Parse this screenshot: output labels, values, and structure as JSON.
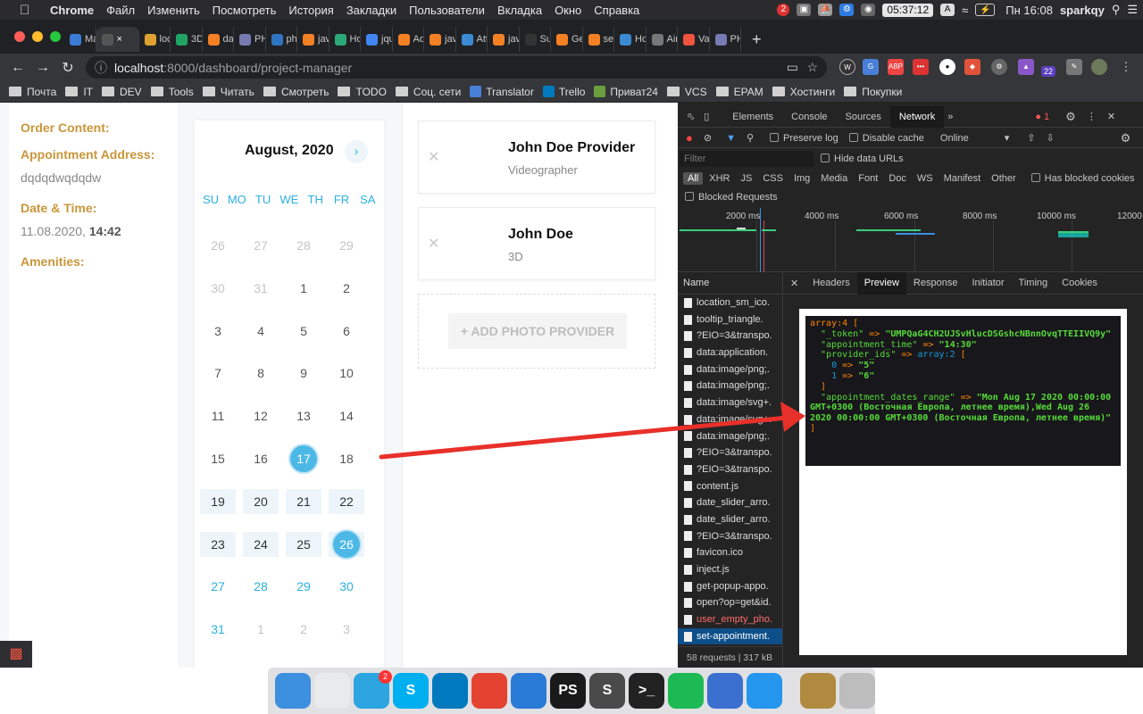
{
  "menubar": {
    "app": "Chrome",
    "items": [
      "Файл",
      "Изменить",
      "Посмотреть",
      "История",
      "Закладки",
      "Пользователи",
      "Вкладка",
      "Окно",
      "Справка"
    ],
    "clock": "05:37:12",
    "input_lang": "A",
    "datetime": "Пн 16:08",
    "user": "sparkqy",
    "notif_badge": "2"
  },
  "tabs": [
    {
      "label": "Mai",
      "icon": "pm-icon",
      "color": "#3a7bd5"
    },
    {
      "label": "",
      "icon": "chrome-icon",
      "color": "#555",
      "active": true
    },
    {
      "label": "loca",
      "icon": "laravel-icon",
      "color": "#e0a030"
    },
    {
      "label": "3D",
      "icon": "sheets-icon",
      "color": "#1fa463"
    },
    {
      "label": "date",
      "icon": "so-icon",
      "color": "#f48024"
    },
    {
      "label": "PHP",
      "icon": "php-icon",
      "color": "#777bb3"
    },
    {
      "label": "php",
      "icon": "php-doc-icon",
      "color": "#2f74c0"
    },
    {
      "label": "java",
      "icon": "so-icon",
      "color": "#f48024"
    },
    {
      "label": "How",
      "icon": "hex-icon",
      "color": "#2aa876"
    },
    {
      "label": "jquery",
      "icon": "google-icon",
      "color": "#4285f4"
    },
    {
      "label": "Add",
      "icon": "so-icon",
      "color": "#f48024"
    },
    {
      "label": "java",
      "icon": "so-icon",
      "color": "#f48024"
    },
    {
      "label": "Attr",
      "icon": "wave-icon",
      "color": "#3b8bd4"
    },
    {
      "label": "java",
      "icon": "so-icon",
      "color": "#f48024"
    },
    {
      "label": "Sub",
      "icon": "github-icon",
      "color": "#333"
    },
    {
      "label": "Get",
      "icon": "so-icon",
      "color": "#f48024"
    },
    {
      "label": "seri",
      "icon": "so-icon",
      "color": "#f48024"
    },
    {
      "label": "How",
      "icon": "wave-icon",
      "color": "#3b8bd4"
    },
    {
      "label": "Air",
      "icon": "globe-icon",
      "color": "#777"
    },
    {
      "label": "Vali",
      "icon": "laravel-icon",
      "color": "#f05340"
    },
    {
      "label": "PHP",
      "icon": "php-icon",
      "color": "#777bb3"
    }
  ],
  "address": {
    "host": "localhost",
    "path": ":8000/dashboard/project-manager"
  },
  "ext_badge": "22",
  "bookmarks": [
    {
      "label": "Почта",
      "type": "folder"
    },
    {
      "label": "IT",
      "type": "folder"
    },
    {
      "label": "DEV",
      "type": "folder"
    },
    {
      "label": "Tools",
      "type": "folder"
    },
    {
      "label": "Читать",
      "type": "folder"
    },
    {
      "label": "Смотреть",
      "type": "folder"
    },
    {
      "label": "TODO",
      "type": "folder"
    },
    {
      "label": "Соц. сети",
      "type": "folder"
    },
    {
      "label": "Translator",
      "type": "site",
      "color": "#4a7fd8"
    },
    {
      "label": "Trello",
      "type": "site",
      "color": "#0079bf"
    },
    {
      "label": "Приват24",
      "type": "site",
      "color": "#6b9e3f"
    },
    {
      "label": "VCS",
      "type": "folder"
    },
    {
      "label": "EPAM",
      "type": "folder"
    },
    {
      "label": "Хостинги",
      "type": "folder"
    },
    {
      "label": "Покупки",
      "type": "folder"
    }
  ],
  "order": {
    "content_label": "Order Content:",
    "address_label": "Appointment Address:",
    "address_value": "dqdqdwqdqdw",
    "datetime_label": "Date & Time:",
    "date_value": "11.08.2020,",
    "time_value": "14:42",
    "amenities_label": "Amenities:"
  },
  "calendar": {
    "title": "August, 2020",
    "next_symbol": "›",
    "weekdays": [
      "SU",
      "MO",
      "TU",
      "WE",
      "TH",
      "FR",
      "SA"
    ],
    "weeks": [
      [
        {
          "d": "26",
          "s": "muted"
        },
        {
          "d": "27",
          "s": "muted"
        },
        {
          "d": "28",
          "s": "muted"
        },
        {
          "d": "29",
          "s": "muted"
        }
      ],
      [
        {
          "d": "30",
          "s": "muted"
        },
        {
          "d": "31",
          "s": "muted"
        },
        {
          "d": "1",
          "s": ""
        },
        {
          "d": "2",
          "s": ""
        }
      ],
      [
        {
          "d": "3",
          "s": ""
        },
        {
          "d": "4",
          "s": ""
        },
        {
          "d": "5",
          "s": ""
        },
        {
          "d": "6",
          "s": ""
        }
      ],
      [
        {
          "d": "7",
          "s": ""
        },
        {
          "d": "8",
          "s": ""
        },
        {
          "d": "9",
          "s": ""
        },
        {
          "d": "10",
          "s": ""
        }
      ],
      [
        {
          "d": "11",
          "s": ""
        },
        {
          "d": "12",
          "s": ""
        },
        {
          "d": "13",
          "s": ""
        },
        {
          "d": "14",
          "s": ""
        }
      ],
      [
        {
          "d": "15",
          "s": ""
        },
        {
          "d": "16",
          "s": ""
        },
        {
          "d": "17",
          "s": "sel"
        },
        {
          "d": "18",
          "s": ""
        }
      ],
      [
        {
          "d": "19",
          "s": "range"
        },
        {
          "d": "20",
          "s": "range"
        },
        {
          "d": "21",
          "s": "range"
        },
        {
          "d": "22",
          "s": "range"
        }
      ],
      [
        {
          "d": "23",
          "s": "range"
        },
        {
          "d": "24",
          "s": "range"
        },
        {
          "d": "25",
          "s": "range"
        },
        {
          "d": "26",
          "s": "sel"
        }
      ],
      [
        {
          "d": "27",
          "s": "next"
        },
        {
          "d": "28",
          "s": "next"
        },
        {
          "d": "29",
          "s": "next"
        },
        {
          "d": "30",
          "s": "next"
        }
      ],
      [
        {
          "d": "31",
          "s": "next"
        },
        {
          "d": "1",
          "s": "muted"
        },
        {
          "d": "2",
          "s": "muted"
        },
        {
          "d": "3",
          "s": "muted"
        }
      ]
    ]
  },
  "providers": [
    {
      "name": "John Doe Provider",
      "role": "Videographer"
    },
    {
      "name": "John Doe",
      "role": "3D"
    }
  ],
  "add_provider_label": "+ ADD PHOTO PROVIDER",
  "devtools": {
    "panels": [
      "Elements",
      "Console",
      "Sources",
      "Network"
    ],
    "active_panel": "Network",
    "error_count": "1",
    "preserve_log": "Preserve log",
    "disable_cache": "Disable cache",
    "throttle": "Online",
    "filter_placeholder": "Filter",
    "hide_data_urls": "Hide data URLs",
    "types": [
      "All",
      "XHR",
      "JS",
      "CSS",
      "Img",
      "Media",
      "Font",
      "Doc",
      "WS",
      "Manifest",
      "Other"
    ],
    "has_blocked": "Has blocked cookies",
    "blocked_requests": "Blocked Requests",
    "timeline_labels": [
      "2000 ms",
      "4000 ms",
      "6000 ms",
      "8000 ms",
      "10000 ms",
      "12000"
    ],
    "name_header": "Name",
    "requests": [
      {
        "name": "location_sm_ico.",
        "t": ""
      },
      {
        "name": "tooltip_triangle.",
        "t": ""
      },
      {
        "name": "?EIO=3&transpo.",
        "t": ""
      },
      {
        "name": "data:application.",
        "t": ""
      },
      {
        "name": "data:image/png;.",
        "t": ""
      },
      {
        "name": "data:image/png;.",
        "t": ""
      },
      {
        "name": "data:image/svg+.",
        "t": ""
      },
      {
        "name": "data:image/svg+.",
        "t": ""
      },
      {
        "name": "data:image/png;.",
        "t": ""
      },
      {
        "name": "?EIO=3&transpo.",
        "t": ""
      },
      {
        "name": "?EIO=3&transpo.",
        "t": ""
      },
      {
        "name": "content.js",
        "t": ""
      },
      {
        "name": "date_slider_arro.",
        "t": ""
      },
      {
        "name": "date_slider_arro.",
        "t": ""
      },
      {
        "name": "?EIO=3&transpo.",
        "t": ""
      },
      {
        "name": "favicon.ico",
        "t": ""
      },
      {
        "name": "inject.js",
        "t": ""
      },
      {
        "name": "get-popup-appo.",
        "t": ""
      },
      {
        "name": "open?op=get&id.",
        "t": ""
      },
      {
        "name": "user_empty_pho.",
        "t": "err"
      },
      {
        "name": "set-appointment.",
        "t": "sel"
      }
    ],
    "footer": "58 requests | 317 kB",
    "detail_tabs": [
      "Headers",
      "Preview",
      "Response",
      "Initiator",
      "Timing",
      "Cookies"
    ],
    "active_detail": "Preview",
    "dump": {
      "head": "array:4 [",
      "token_key": "\"_token\"",
      "token_val": "\"UMPQaG4CH2UJSvHlucDSGshcNBnnOvqTTEIIVQ9y\"",
      "time_key": "\"appointment_time\"",
      "time_val": "\"14:30\"",
      "ids_key": "\"provider_ids\"",
      "ids_type": "array:2",
      "ids": [
        {
          "i": "0",
          "v": "\"5\""
        },
        {
          "i": "1",
          "v": "\"6\""
        }
      ],
      "range_key": "\"appointment_dates_range\"",
      "range_val": "\"Mon Aug 17 2020 00:00:00 GMT+0300 (Восточная Европа, летнее время),Wed Aug 26 2020 00:00:00 GMT+0300 (Восточная Европа, летнее время)\"",
      "arrow": "=>",
      "open": "[",
      "close": "]"
    }
  },
  "dock": [
    {
      "name": "finder-icon",
      "color": "#3d8fe0",
      "label": ""
    },
    {
      "name": "chrome-app-icon",
      "color": "#e9eaec",
      "label": ""
    },
    {
      "name": "telegram-icon",
      "color": "#2ca5e0",
      "label": "",
      "badge": "2"
    },
    {
      "name": "skype-icon",
      "color": "#00aff0",
      "label": "S"
    },
    {
      "name": "trello-app-icon",
      "color": "#0079bf",
      "label": ""
    },
    {
      "name": "todoist-icon",
      "color": "#e44332",
      "label": ""
    },
    {
      "name": "paw-icon",
      "color": "#2a7ad8",
      "label": ""
    },
    {
      "name": "phpstorm-icon",
      "color": "#1a1a1a",
      "label": "PS"
    },
    {
      "name": "sublime-icon",
      "color": "#4a4a4a",
      "label": "S"
    },
    {
      "name": "terminal-icon",
      "color": "#222",
      "label": ">_"
    },
    {
      "name": "spotify-icon",
      "color": "#1db954",
      "label": ""
    },
    {
      "name": "wave-app-icon",
      "color": "#3b6fd0",
      "label": ""
    },
    {
      "name": "docker-icon",
      "color": "#2496ed",
      "label": ""
    },
    {
      "name": "league-icon",
      "color": "#b08a3e",
      "label": ""
    },
    {
      "name": "trash-icon",
      "color": "#bdbdbd",
      "label": ""
    }
  ]
}
